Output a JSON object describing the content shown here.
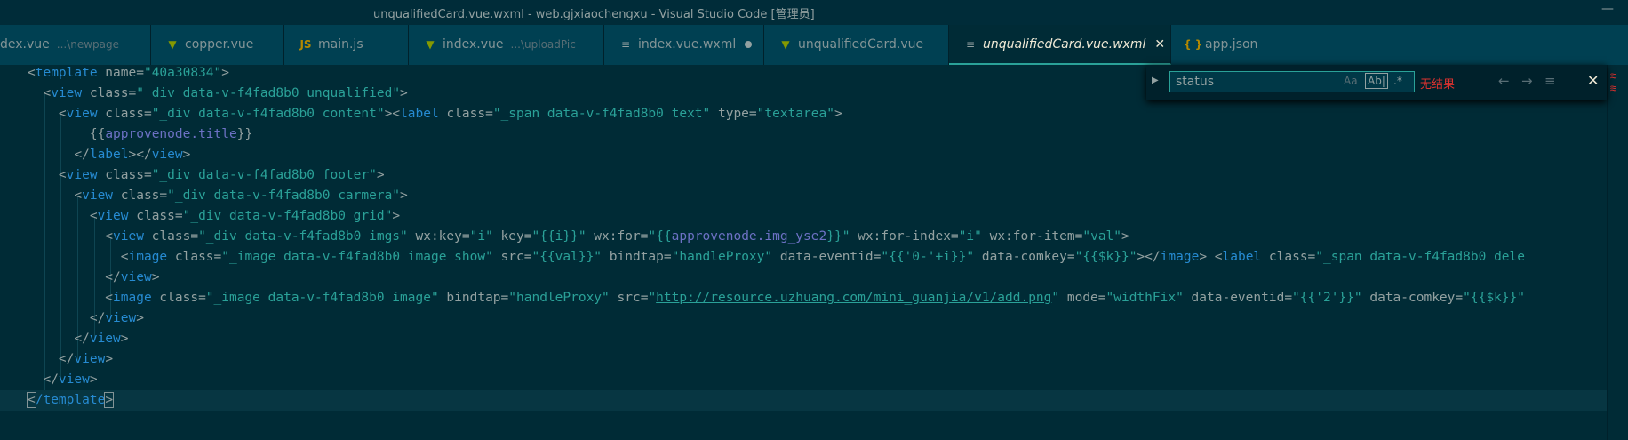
{
  "window": {
    "title": "unqualifiedCard.vue.wxml - web.gjxiaochengxu - Visual Studio Code [管理员]",
    "minimize": "—"
  },
  "tabs": [
    {
      "label": "dex.vue",
      "hint": "...\\newpage",
      "icon": "vue-icon",
      "glyph": ""
    },
    {
      "label": "copper.vue",
      "hint": "",
      "icon": "vue-icon",
      "glyph": "▼"
    },
    {
      "label": "main.js",
      "hint": "",
      "icon": "js-icon",
      "glyph": "JS"
    },
    {
      "label": "index.vue",
      "hint": "...\\uploadPic",
      "icon": "vue-icon",
      "glyph": "▼"
    },
    {
      "label": "index.vue.wxml",
      "hint": "",
      "icon": "lines-icon",
      "glyph": "≡"
    },
    {
      "label": "unqualifiedCard.vue",
      "hint": "",
      "icon": "vue-icon",
      "glyph": "▼"
    },
    {
      "label": "unqualifiedCard.vue.wxml",
      "hint": "",
      "icon": "lines-icon",
      "glyph": "≡",
      "close": "✕"
    },
    {
      "label": "app.json",
      "hint": "",
      "icon": "json-icon",
      "glyph": "{ }"
    }
  ],
  "find": {
    "toggle": "▶",
    "query": "status",
    "match_case": "Aa",
    "whole_word": "Ab|",
    "regex": ".*",
    "result": "无结果",
    "prev": "←",
    "next": "→",
    "in_selection": "≡",
    "close": "✕"
  },
  "minimap": {
    "marks": [
      "≋",
      "≋"
    ]
  },
  "code": {
    "lines": [
      {
        "tokens": [
          [
            "pu",
            "<"
          ],
          [
            "tg",
            "template"
          ],
          [
            "at",
            " name="
          ],
          [
            "st",
            "\"40a30834\""
          ],
          [
            "pu",
            ">"
          ]
        ]
      },
      {
        "tokens": [
          [
            "pu",
            "  <"
          ],
          [
            "tg",
            "view"
          ],
          [
            "at",
            " class="
          ],
          [
            "st",
            "\"_div data-v-f4fad8b0 unqualified\""
          ],
          [
            "pu",
            ">"
          ]
        ]
      },
      {
        "tokens": [
          [
            "pu",
            "    <"
          ],
          [
            "tg",
            "view"
          ],
          [
            "at",
            " class="
          ],
          [
            "st",
            "\"_div data-v-f4fad8b0 content\""
          ],
          [
            "pu",
            "><"
          ],
          [
            "tg",
            "label"
          ],
          [
            "at",
            " class="
          ],
          [
            "st",
            "\"_span data-v-f4fad8b0 text\""
          ],
          [
            "at",
            " type="
          ],
          [
            "st",
            "\"textarea\""
          ],
          [
            "pu",
            ">"
          ]
        ]
      },
      {
        "tokens": [
          [
            "tx",
            "        {{"
          ],
          [
            "ex",
            "approvenode.title"
          ],
          [
            "tx",
            "}}"
          ]
        ]
      },
      {
        "tokens": [
          [
            "pu",
            "      </"
          ],
          [
            "tg",
            "label"
          ],
          [
            "pu",
            "></"
          ],
          [
            "tg",
            "view"
          ],
          [
            "pu",
            ">"
          ]
        ]
      },
      {
        "tokens": [
          [
            "pu",
            "    <"
          ],
          [
            "tg",
            "view"
          ],
          [
            "at",
            " class="
          ],
          [
            "st",
            "\"_div data-v-f4fad8b0 footer\""
          ],
          [
            "pu",
            ">"
          ]
        ]
      },
      {
        "tokens": [
          [
            "pu",
            "      <"
          ],
          [
            "tg",
            "view"
          ],
          [
            "at",
            " class="
          ],
          [
            "st",
            "\"_div data-v-f4fad8b0 carmera\""
          ],
          [
            "pu",
            ">"
          ]
        ]
      },
      {
        "tokens": [
          [
            "pu",
            "        <"
          ],
          [
            "tg",
            "view"
          ],
          [
            "at",
            " class="
          ],
          [
            "st",
            "\"_div data-v-f4fad8b0 grid\""
          ],
          [
            "pu",
            ">"
          ]
        ]
      },
      {
        "tokens": [
          [
            "pu",
            "          <"
          ],
          [
            "tg",
            "view"
          ],
          [
            "at",
            " class="
          ],
          [
            "st",
            "\"_div data-v-f4fad8b0 imgs\""
          ],
          [
            "at",
            " wx:key="
          ],
          [
            "st",
            "\"i\""
          ],
          [
            "at",
            " key="
          ],
          [
            "st",
            "\"{{i}}\""
          ],
          [
            "at",
            " wx:for="
          ],
          [
            "st",
            "\"{{"
          ],
          [
            "ex",
            "approvenode.img_yse2"
          ],
          [
            "st",
            "}}\""
          ],
          [
            "at",
            " wx:for-index="
          ],
          [
            "st",
            "\"i\""
          ],
          [
            "at",
            " wx:for-item="
          ],
          [
            "st",
            "\"val\""
          ],
          [
            "pu",
            ">"
          ]
        ]
      },
      {
        "tokens": [
          [
            "pu",
            "            <"
          ],
          [
            "tg",
            "image"
          ],
          [
            "at",
            " class="
          ],
          [
            "st",
            "\"_image data-v-f4fad8b0 image show\""
          ],
          [
            "at",
            " src="
          ],
          [
            "st",
            "\"{{val}}\""
          ],
          [
            "at",
            " bindtap="
          ],
          [
            "st",
            "\"handleProxy\""
          ],
          [
            "at",
            " data-eventid="
          ],
          [
            "st",
            "\"{{'0-'+i}}\""
          ],
          [
            "at",
            " data-comkey="
          ],
          [
            "st",
            "\"{{$k}}\""
          ],
          [
            "pu",
            "></"
          ],
          [
            "tg",
            "image"
          ],
          [
            "pu",
            "> <"
          ],
          [
            "tg",
            "label"
          ],
          [
            "at",
            " class="
          ],
          [
            "st",
            "\"_span data-v-f4fad8b0 dele"
          ]
        ]
      },
      {
        "tokens": [
          [
            "pu",
            "          </"
          ],
          [
            "tg",
            "view"
          ],
          [
            "pu",
            ">"
          ]
        ]
      },
      {
        "tokens": [
          [
            "pu",
            "          <"
          ],
          [
            "tg",
            "image"
          ],
          [
            "at",
            " class="
          ],
          [
            "st",
            "\"_image data-v-f4fad8b0 image\""
          ],
          [
            "at",
            " bindtap="
          ],
          [
            "st",
            "\"handleProxy\""
          ],
          [
            "at",
            " src="
          ],
          [
            "st",
            "\""
          ],
          [
            "ul",
            "http://resource.uzhuang.com/mini_guanjia/v1/add.png"
          ],
          [
            "st",
            "\""
          ],
          [
            "at",
            " mode="
          ],
          [
            "st",
            "\"widthFix\""
          ],
          [
            "at",
            " data-eventid="
          ],
          [
            "st",
            "\"{{'2'}}\""
          ],
          [
            "at",
            " data-comkey="
          ],
          [
            "st",
            "\"{{$k}}\""
          ]
        ]
      },
      {
        "tokens": [
          [
            "pu",
            "        </"
          ],
          [
            "tg",
            "view"
          ],
          [
            "pu",
            ">"
          ]
        ]
      },
      {
        "tokens": [
          [
            "pu",
            "      </"
          ],
          [
            "tg",
            "view"
          ],
          [
            "pu",
            ">"
          ]
        ]
      },
      {
        "tokens": [
          [
            "pu",
            "    </"
          ],
          [
            "tg",
            "view"
          ],
          [
            "pu",
            ">"
          ]
        ]
      },
      {
        "tokens": [
          [
            "pu",
            "  </"
          ],
          [
            "tg",
            "view"
          ],
          [
            "pu",
            ">"
          ]
        ]
      },
      {
        "tokens": [
          [
            "bx",
            "<"
          ],
          [
            "tg",
            "/template"
          ],
          [
            "bx",
            ">"
          ]
        ]
      }
    ]
  }
}
